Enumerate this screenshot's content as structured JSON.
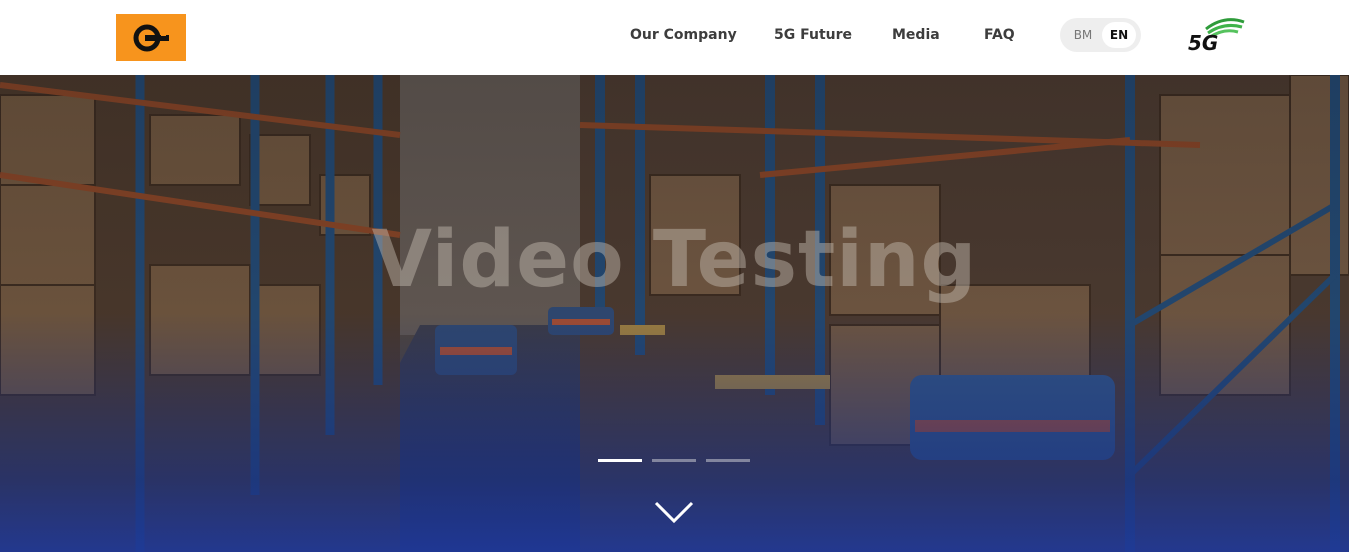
{
  "header": {
    "logo_icon": "company-logo-icon",
    "brand_color": "#f7941d",
    "nav": [
      {
        "label": "Our Company"
      },
      {
        "label": "5G Future"
      },
      {
        "label": "Media"
      },
      {
        "label": "FAQ"
      }
    ],
    "language": {
      "options": [
        "BM",
        "EN"
      ],
      "selected": "EN"
    },
    "badge_label": "5G"
  },
  "hero": {
    "title": "Video Testing",
    "slides_total": 3,
    "active_slide": 1,
    "scroll_icon": "chevron-down-icon",
    "background": "warehouse-with-robots"
  }
}
